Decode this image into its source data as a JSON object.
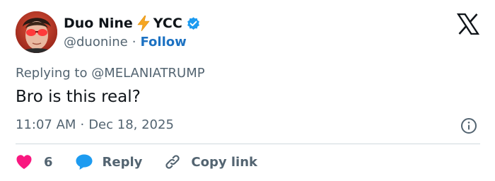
{
  "author": {
    "display_name": "Duo Nine",
    "badge_text": "YCC",
    "handle": "@duonine",
    "separator": "·",
    "follow_label": "Follow"
  },
  "post": {
    "replying_to": "Replying to @MELANIATRUMP",
    "text": "Bro is this real?",
    "time": "11:07 AM",
    "date": "Dec 18, 2025",
    "date_separator": "·"
  },
  "actions": {
    "like_count": "6",
    "reply_label": "Reply",
    "copy_label": "Copy link"
  },
  "icons": {
    "bolt": "lightning-bolt-icon",
    "verified": "verified-badge-icon",
    "logo": "x-logo-icon",
    "info": "info-icon",
    "like": "heart-icon",
    "reply": "speech-bubble-icon",
    "copy": "link-icon"
  },
  "colors": {
    "text_primary": "#0f1419",
    "text_secondary": "#536471",
    "follow": "#1d72c2",
    "verified": "#1d9bf0",
    "like": "#f91880",
    "reply_icon": "#1d9bf0",
    "bolt": "#f5a623",
    "divider": "#cfd9de"
  }
}
